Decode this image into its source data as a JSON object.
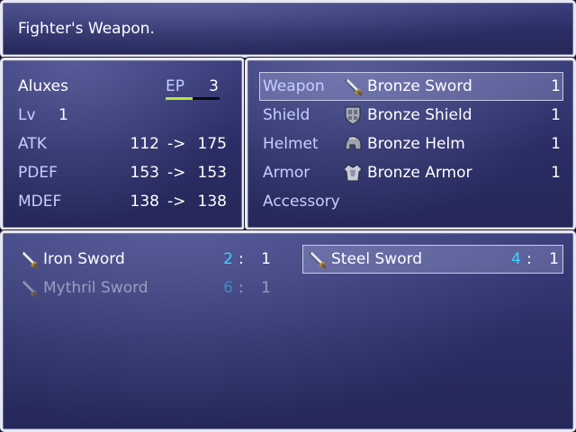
{
  "help": {
    "text": "Fighter's Weapon."
  },
  "status": {
    "name": "Aluxes",
    "ep_label": "EP",
    "ep_value": "3",
    "ep_fraction": 0.5,
    "level_label": "Lv",
    "level_value": "1",
    "arrow": "->",
    "params": [
      {
        "label": "ATK",
        "current": "112",
        "new": "175"
      },
      {
        "label": "PDEF",
        "current": "153",
        "new": "153"
      },
      {
        "label": "MDEF",
        "current": "138",
        "new": "138"
      }
    ]
  },
  "equipment": {
    "slots": [
      {
        "label": "Weapon",
        "item": "Bronze Sword",
        "icon": "sword-icon",
        "count": "1",
        "selected": true
      },
      {
        "label": "Shield",
        "item": "Bronze Shield",
        "icon": "shield-icon",
        "count": "1"
      },
      {
        "label": "Helmet",
        "item": "Bronze Helm",
        "icon": "helmet-icon",
        "count": "1"
      },
      {
        "label": "Armor",
        "item": "Bronze Armor",
        "icon": "armor-icon",
        "count": "1"
      },
      {
        "label": "Accessory",
        "item": "",
        "icon": "",
        "count": ""
      }
    ]
  },
  "items": {
    "colon": ":",
    "list": [
      {
        "name": "Iron Sword",
        "icon": "sword-icon",
        "ep": "2",
        "count": "1",
        "enabled": true
      },
      {
        "name": "Steel Sword",
        "icon": "sword-icon",
        "ep": "4",
        "count": "1",
        "enabled": true,
        "selected": true
      },
      {
        "name": "Mythril Sword",
        "icon": "sword-icon",
        "ep": "6",
        "count": "1",
        "enabled": false
      }
    ]
  },
  "colors": {
    "window_top": "#3b3f7c",
    "window_bottom": "#252858",
    "system_text": "#c4d0ff",
    "ep_cost": "#38d4ff",
    "ep_bar": "#b6e444"
  }
}
